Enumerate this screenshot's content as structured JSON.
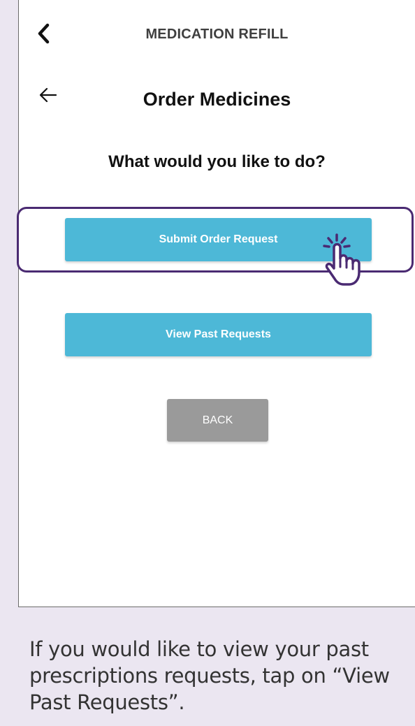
{
  "header": {
    "title": "MEDICATION REFILL",
    "back_icon": "chevron-left-icon"
  },
  "page": {
    "back_icon": "arrow-left-icon",
    "title": "Order Medicines",
    "question": "What would you like to do?"
  },
  "actions": {
    "submit_label": "Submit Order Request",
    "view_label": "View Past Requests",
    "back_label": "BACK"
  },
  "overlay": {
    "highlight_color": "#4a2a72",
    "pointer_icon": "hand-tap-icon"
  },
  "caption": {
    "text": "If you would like to view your past prescriptions requests, tap on “View Past Requests”."
  },
  "colors": {
    "primary_button": "#4db8d7",
    "secondary_button": "#9a9a9a",
    "background": "#ebe6f1"
  }
}
